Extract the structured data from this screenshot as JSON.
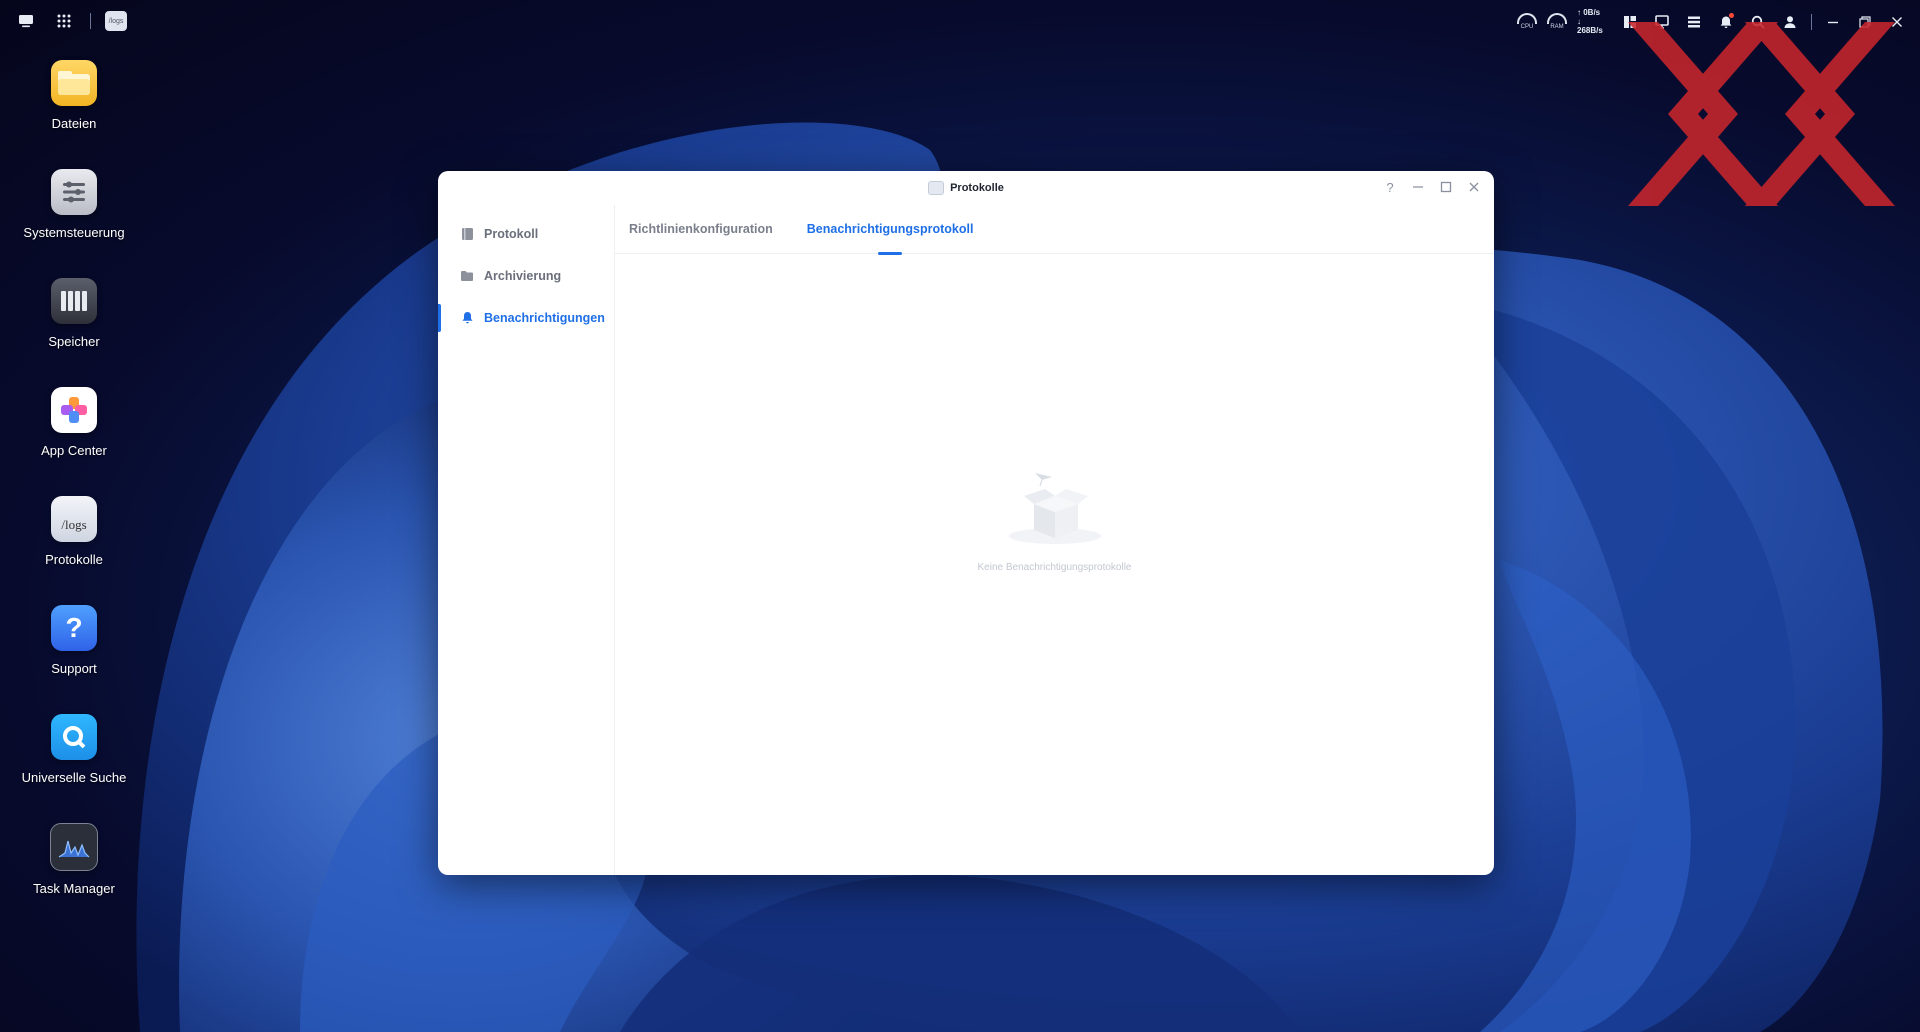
{
  "topbar": {
    "tray": {
      "gauge_cpu": "CPU",
      "gauge_ram": "RAM",
      "net_up": "↑ 0B/s",
      "net_down": "↓ 268B/s"
    }
  },
  "taskbar_app": {
    "label": "/logs"
  },
  "desktop": {
    "icons": [
      {
        "label": "Dateien",
        "icon": "folder-icon"
      },
      {
        "label": "Systemsteuerung",
        "icon": "control-panel-icon"
      },
      {
        "label": "Speicher",
        "icon": "storage-icon"
      },
      {
        "label": "App Center",
        "icon": "app-center-icon"
      },
      {
        "label": "Protokolle",
        "icon": "logs-icon",
        "badge": "/logs"
      },
      {
        "label": "Support",
        "icon": "support-icon",
        "glyph": "?"
      },
      {
        "label": "Universelle Suche",
        "icon": "search-app-icon"
      },
      {
        "label": "Task Manager",
        "icon": "task-manager-icon"
      }
    ]
  },
  "window": {
    "title": "Protokolle",
    "controls": {
      "help": "?"
    },
    "sidebar": [
      {
        "label": "Protokoll",
        "icon": "log-book-icon",
        "active": false
      },
      {
        "label": "Archivierung",
        "icon": "folder-icon",
        "active": false
      },
      {
        "label": "Benachrichtigungen",
        "icon": "bell-icon",
        "active": true
      }
    ],
    "tabs": [
      {
        "label": "Richtlinienkonfiguration",
        "active": false
      },
      {
        "label": "Benachrichtigungsprotokoll",
        "active": true
      }
    ],
    "empty_state": {
      "text": "Keine Benachrichtigungsprotokolle",
      "icon": "empty-box-icon"
    }
  },
  "colors": {
    "accent": "#1f6fe6",
    "desktop_bg": "#070a2c",
    "watermark": "#c8262c"
  }
}
